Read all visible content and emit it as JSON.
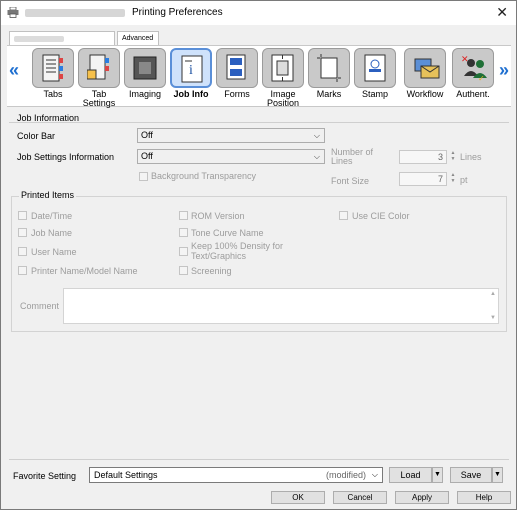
{
  "window": {
    "title": "Printing Preferences"
  },
  "tabs": [
    {
      "label": ""
    },
    {
      "label": "Advanced"
    }
  ],
  "iconbar": {
    "items": [
      {
        "label": "Tabs",
        "icon": "binder-tabs-icon"
      },
      {
        "label": "Tab\nSettings",
        "icon": "tab-settings-icon"
      },
      {
        "label": "Imaging",
        "icon": "imaging-icon"
      },
      {
        "label": "Job Info",
        "icon": "job-info-icon",
        "selected": true
      },
      {
        "label": "Forms",
        "icon": "forms-icon"
      },
      {
        "label": "Image\nPosition",
        "icon": "image-position-icon"
      },
      {
        "label": "Marks",
        "icon": "marks-icon"
      },
      {
        "label": "Stamp",
        "icon": "stamp-icon"
      },
      {
        "label": "Workflow",
        "icon": "workflow-icon"
      },
      {
        "label": "Authent.",
        "icon": "authentication-icon"
      }
    ]
  },
  "job_information": {
    "section_title": "Job Information",
    "color_bar_label": "Color Bar",
    "color_bar_value": "Off",
    "job_settings_label": "Job Settings Information",
    "job_settings_value": "Off",
    "background_transparency_label": "Background Transparency",
    "number_of_lines_label": "Number of\nLines",
    "number_of_lines_value": "3",
    "lines_unit": "Lines",
    "font_size_label": "Font Size",
    "font_size_value": "7",
    "font_size_unit": "pt"
  },
  "printed_items": {
    "section_title": "Printed Items",
    "items": [
      "Date/Time",
      "Job Name",
      "User Name",
      "Printer Name/Model Name",
      "ROM Version",
      "Tone Curve Name",
      "Keep 100% Density for\nText/Graphics",
      "Screening",
      "Use CIE Color"
    ],
    "comment_label": "Comment"
  },
  "favorite": {
    "label": "Favorite Setting",
    "value": "Default Settings",
    "modified": "(modified)",
    "load_label": "Load",
    "save_label": "Save"
  },
  "buttons": {
    "ok": "OK",
    "cancel": "Cancel",
    "apply": "Apply",
    "help": "Help"
  }
}
